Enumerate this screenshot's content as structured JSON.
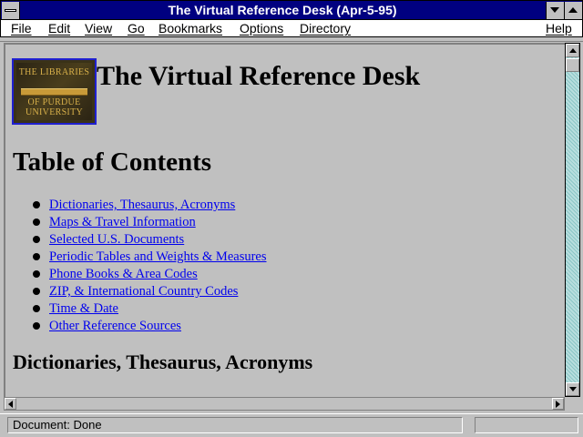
{
  "window": {
    "title": "The Virtual Reference Desk (Apr-5-95)"
  },
  "menubar": {
    "items": [
      "File",
      "Edit",
      "View",
      "Go",
      "Bookmarks",
      "Options",
      "Directory",
      "Help"
    ]
  },
  "page": {
    "logo_lines": [
      "THE LIBRARIES",
      "OF PURDUE",
      "UNIVERSITY"
    ],
    "heading": "The Virtual Reference Desk",
    "toc_heading": "Table of Contents",
    "toc_links": [
      "Dictionaries, Thesaurus, Acronyms",
      "Maps & Travel Information",
      "Selected U.S. Documents",
      "Periodic Tables and Weights & Measures",
      "Phone Books & Area Codes",
      "ZIP, & International Country Codes",
      "Time & Date",
      "Other Reference Sources"
    ],
    "section_heading": "Dictionaries, Thesaurus, Acronyms"
  },
  "statusbar": {
    "text": "Document: Done"
  },
  "colors": {
    "titlebar": "#000080",
    "link": "#0000ee",
    "background": "#c0c0c0"
  }
}
